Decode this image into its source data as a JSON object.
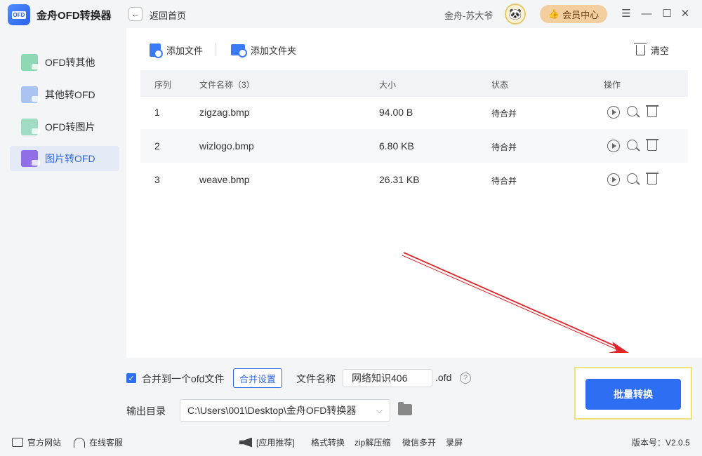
{
  "app": {
    "title": "金舟OFD转换器",
    "logo_text": "OFD"
  },
  "header": {
    "back_label": "返回首页",
    "user_name": "金舟-苏大爷",
    "vip_label": "会员中心"
  },
  "sidebar": {
    "items": [
      {
        "label": "OFD转其他",
        "color": "#8fd8b4"
      },
      {
        "label": "其他转OFD",
        "color": "#a9c4f0"
      },
      {
        "label": "OFD转图片",
        "color": "#9fdcc3"
      },
      {
        "label": "图片转OFD",
        "color": "#8f6ee8",
        "active": true
      }
    ]
  },
  "toolbar": {
    "add_file": "添加文件",
    "add_folder": "添加文件夹",
    "clear": "清空"
  },
  "table": {
    "headers": {
      "index": "序列",
      "name": "文件名称（3）",
      "size": "大小",
      "status": "状态",
      "actions": "操作"
    },
    "rows": [
      {
        "index": "1",
        "name": "zigzag.bmp",
        "size": "94.00 B",
        "status": "待合并"
      },
      {
        "index": "2",
        "name": "wizlogo.bmp",
        "size": "6.80 KB",
        "status": "待合并"
      },
      {
        "index": "3",
        "name": "weave.bmp",
        "size": "26.31 KB",
        "status": "待合并"
      }
    ]
  },
  "settings": {
    "merge_label": "合并到一个ofd文件",
    "merge_settings": "合并设置",
    "filename_label": "文件名称",
    "filename_value": "网络知识406",
    "ext": ".ofd",
    "help": "?",
    "output_label": "输出目录",
    "output_path": "C:\\Users\\001\\Desktop\\金舟OFD转换器"
  },
  "convert_button": "批量转换",
  "footer": {
    "official_site": "官方网站",
    "online_service": "在线客服",
    "recommend": "[应用推荐]",
    "links": [
      "格式转换",
      "zip解压缩",
      "微信多开",
      "录屏"
    ],
    "version": "版本号：V2.0.5"
  },
  "colors": {
    "accent": "#2d6ef2",
    "annotation_arrow": "#e0262b",
    "highlight_border": "#f2e27a"
  }
}
